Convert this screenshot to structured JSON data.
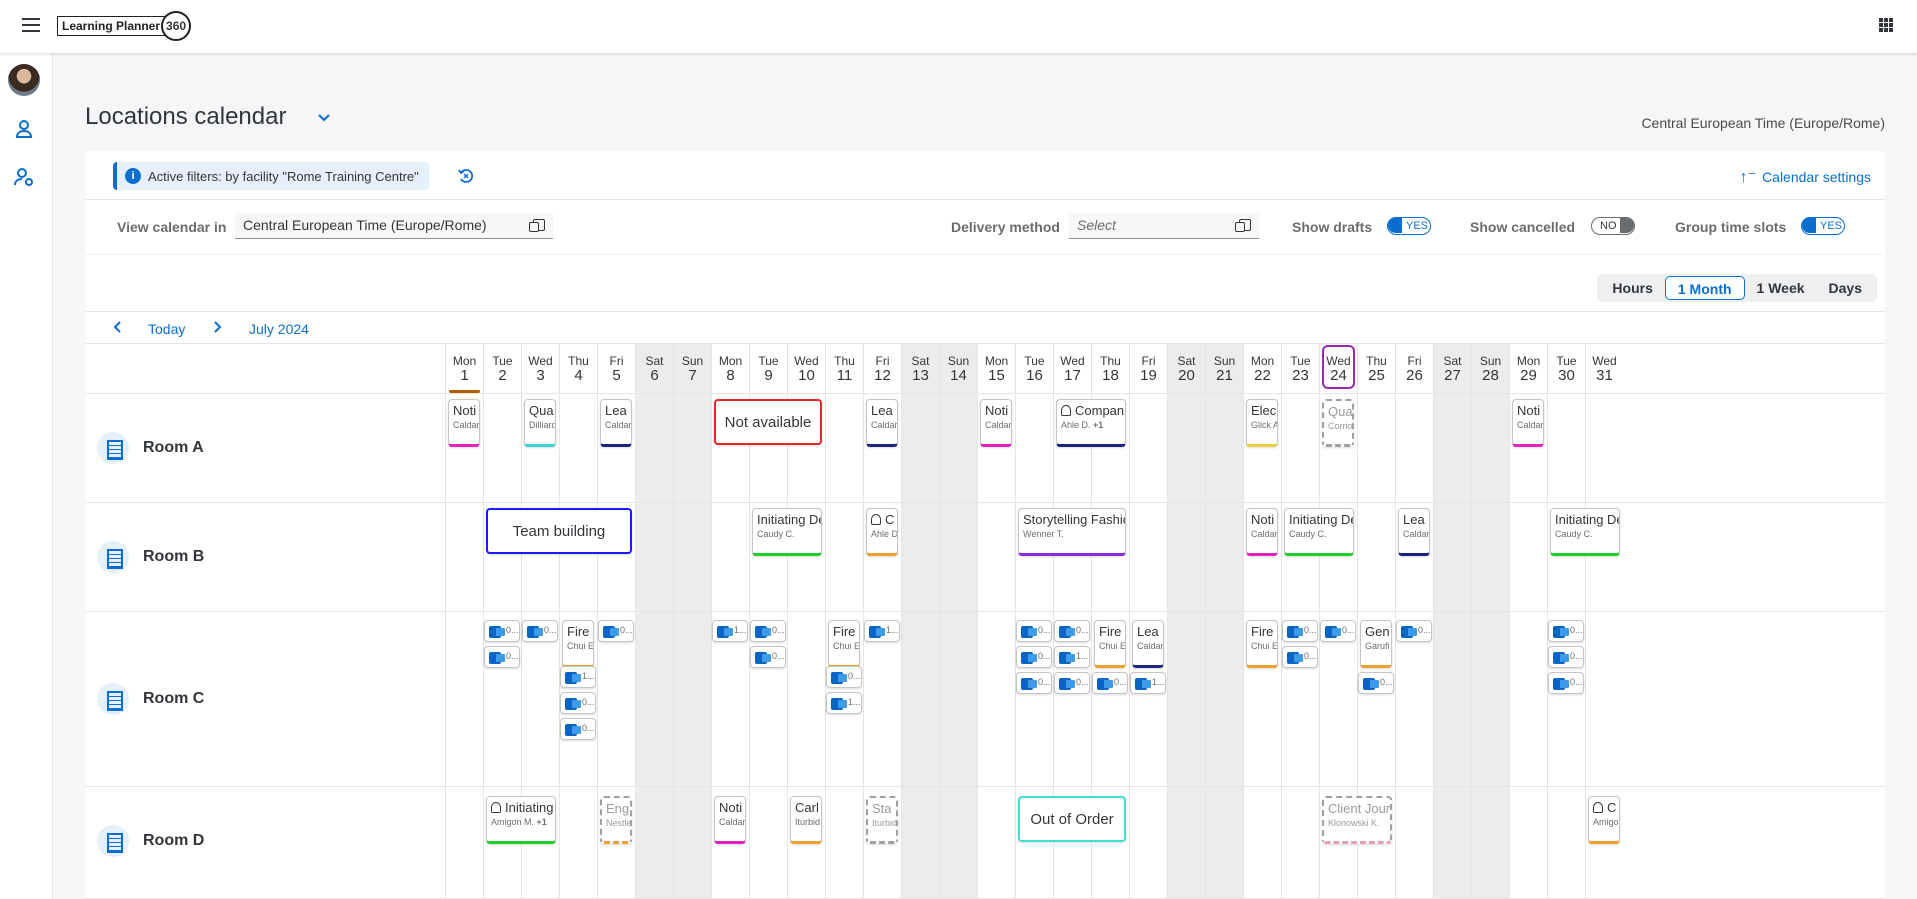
{
  "app": {
    "name": "Learning Planner",
    "logo_number": "360"
  },
  "page": {
    "title": "Locations calendar",
    "timezone": "Central European Time (Europe/Rome)"
  },
  "filters": {
    "active_text": "Active filters: by facility \"Rome Training Centre\"",
    "settings_label": "Calendar settings"
  },
  "toolbar": {
    "view_in_label": "View calendar in",
    "view_in_value": "Central European Time (Europe/Rome)",
    "delivery_label": "Delivery method",
    "delivery_placeholder": "Select",
    "drafts_label": "Show drafts",
    "drafts_value": "YES",
    "cancelled_label": "Show cancelled",
    "cancelled_value": "NO",
    "group_label": "Group time slots",
    "group_value": "YES"
  },
  "views": [
    "Hours",
    "1 Month",
    "1 Week",
    "Days"
  ],
  "active_view": "1 Month",
  "nav": {
    "today": "Today",
    "month": "July 2024"
  },
  "days": [
    {
      "d": "Mon",
      "n": "1"
    },
    {
      "d": "Tue",
      "n": "2"
    },
    {
      "d": "Wed",
      "n": "3"
    },
    {
      "d": "Thu",
      "n": "4"
    },
    {
      "d": "Fri",
      "n": "5"
    },
    {
      "d": "Sat",
      "n": "6"
    },
    {
      "d": "Sun",
      "n": "7"
    },
    {
      "d": "Mon",
      "n": "8"
    },
    {
      "d": "Tue",
      "n": "9"
    },
    {
      "d": "Wed",
      "n": "10"
    },
    {
      "d": "Thu",
      "n": "11"
    },
    {
      "d": "Fri",
      "n": "12"
    },
    {
      "d": "Sat",
      "n": "13"
    },
    {
      "d": "Sun",
      "n": "14"
    },
    {
      "d": "Mon",
      "n": "15"
    },
    {
      "d": "Tue",
      "n": "16"
    },
    {
      "d": "Wed",
      "n": "17"
    },
    {
      "d": "Thu",
      "n": "18"
    },
    {
      "d": "Fri",
      "n": "19"
    },
    {
      "d": "Sat",
      "n": "20"
    },
    {
      "d": "Sun",
      "n": "21"
    },
    {
      "d": "Mon",
      "n": "22"
    },
    {
      "d": "Tue",
      "n": "23"
    },
    {
      "d": "Wed",
      "n": "24"
    },
    {
      "d": "Thu",
      "n": "25"
    },
    {
      "d": "Fri",
      "n": "26"
    },
    {
      "d": "Sat",
      "n": "27"
    },
    {
      "d": "Sun",
      "n": "28"
    },
    {
      "d": "Mon",
      "n": "29"
    },
    {
      "d": "Tue",
      "n": "30"
    },
    {
      "d": "Wed",
      "n": "31"
    }
  ],
  "rooms": [
    "Room A",
    "Room B",
    "Room C",
    "Room D"
  ],
  "events": {
    "a_noti1": {
      "t": "Noti",
      "s": "Caldar"
    },
    "a_qua": {
      "t": "Qua",
      "s": "Dilliard"
    },
    "a_lea1": {
      "t": "Lea",
      "s": "Caldar"
    },
    "a_na": {
      "t": "Not available"
    },
    "a_lea2": {
      "t": "Lea",
      "s": "Caldar"
    },
    "a_noti2": {
      "t": "Noti",
      "s": "Caldar"
    },
    "a_comp": {
      "t": "Compan",
      "s": "Ahle D.",
      "extra": "+1"
    },
    "a_elec": {
      "t": "Elec",
      "s": "Glick A"
    },
    "a_qua2": {
      "t": "Qua",
      "s": "Corrio"
    },
    "a_noti3": {
      "t": "Noti",
      "s": "Caldar"
    },
    "b_team": {
      "t": "Team building"
    },
    "b_init1": {
      "t": "Initiating De",
      "s": "Caudy C."
    },
    "b_c1": {
      "t": "C",
      "s": "Ahle D"
    },
    "b_story": {
      "t": "Storytelling Fashion",
      "s": "Wenner T."
    },
    "b_noti": {
      "t": "Noti",
      "s": "Caldar"
    },
    "b_init2": {
      "t": "Initiating De",
      "s": "Caudy C."
    },
    "b_lea": {
      "t": "Lea",
      "s": "Caldar"
    },
    "b_init3": {
      "t": "Initiating De",
      "s": "Caudy C."
    },
    "c_fire1": {
      "t": "Fire",
      "s": "Chui E"
    },
    "c_fire2": {
      "t": "Fire",
      "s": "Chui E"
    },
    "c_fire3": {
      "t": "Fire",
      "s": "Chui E"
    },
    "c_lea": {
      "t": "Lea",
      "s": "Caldar"
    },
    "c_fire4": {
      "t": "Fire",
      "s": "Chui E"
    },
    "c_gen": {
      "t": "Gen",
      "s": "Garufi"
    },
    "d_init": {
      "t": "Initiating",
      "s": "Amigon M.",
      "extra": "+1"
    },
    "d_eng": {
      "t": "Eng",
      "s": "Nestle"
    },
    "d_noti": {
      "t": "Noti",
      "s": "Caldar"
    },
    "d_carl": {
      "t": "Carl",
      "s": "Iturbid"
    },
    "d_sta": {
      "t": "Sta",
      "s": "Iturbid"
    },
    "d_ooo": {
      "t": "Out of Order"
    },
    "d_client": {
      "t": "Client Jour",
      "s": "Klonowski K."
    },
    "d_c": {
      "t": "C",
      "s": "Amigo"
    }
  },
  "mini_labels": {
    "zero": "0...",
    "one": "1..."
  },
  "colors": {
    "accent": "#0a6ed1",
    "today": "#9c27b0",
    "not_available": "#e8252a",
    "team_building": "#1a1aff",
    "out_of_order": "#40e0d0"
  }
}
